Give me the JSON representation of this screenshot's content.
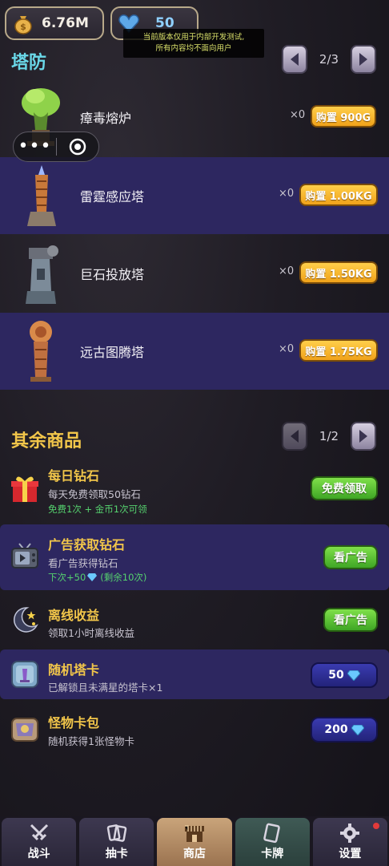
{
  "topbar": {
    "gold": "6.76M",
    "gems": "50",
    "notice_line1": "当前版本仅用于内部开发测试,",
    "notice_line2": "所有内容均不面向用户"
  },
  "towers_section": {
    "title": "塔防",
    "page": "2/3",
    "items": [
      {
        "name": "瘴毒熔炉",
        "count": "×0",
        "price": "购置 900G",
        "icon": "poison-furnace-icon"
      },
      {
        "name": "雷霆感应塔",
        "count": "×0",
        "price": "购置 1.00KG",
        "icon": "thunder-tower-icon"
      },
      {
        "name": "巨石投放塔",
        "count": "×0",
        "price": "购置 1.50KG",
        "icon": "boulder-tower-icon"
      },
      {
        "name": "远古图腾塔",
        "count": "×0",
        "price": "购置 1.75KG",
        "icon": "totem-tower-icon"
      }
    ]
  },
  "capsule": {
    "more": "•••"
  },
  "other_section": {
    "title": "其余商品",
    "page": "1/2",
    "items": [
      {
        "title": "每日钻石",
        "desc": "每天免费领取50钻石",
        "sub": "免费1次 + 金币1次可领",
        "button": "免费领取",
        "icon": "gift-icon"
      },
      {
        "title": "广告获取钻石",
        "desc": "看广告获得钻石",
        "sub_prefix": "下次+50",
        "sub_suffix": "(剩余10次)",
        "button": "看广告",
        "icon": "tv-icon"
      },
      {
        "title": "离线收益",
        "desc": "领取1小时离线收益",
        "button": "看广告",
        "icon": "moon-icon"
      },
      {
        "title": "随机塔卡",
        "desc": "已解锁且未满星的塔卡×1",
        "button": "50",
        "icon": "tower-card-icon"
      },
      {
        "title": "怪物卡包",
        "desc": "随机获得1张怪物卡",
        "button": "200",
        "icon": "monster-pack-icon"
      }
    ]
  },
  "nav": [
    {
      "label": "战斗",
      "icon": "swords-icon"
    },
    {
      "label": "抽卡",
      "icon": "draw-cards-icon"
    },
    {
      "label": "商店",
      "icon": "shop-icon"
    },
    {
      "label": "卡牌",
      "icon": "cards-icon"
    },
    {
      "label": "设置",
      "icon": "gear-icon"
    }
  ],
  "colors": {
    "tower_title": "#6ad8e8",
    "shop_title": "#f2c64a",
    "band": "#2d2760",
    "buy_button": "#f0a21a",
    "green_button": "#3fa625",
    "blue_button": "#23237a"
  }
}
